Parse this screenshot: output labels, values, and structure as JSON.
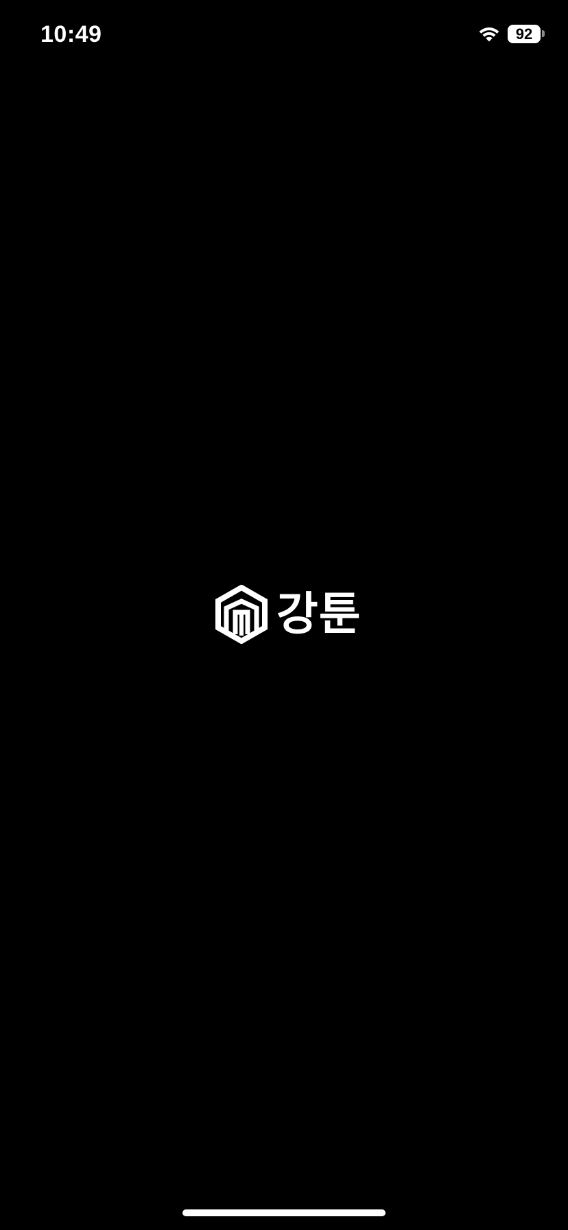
{
  "status_bar": {
    "time": "10:49",
    "battery_level": "92",
    "battery_fraction": 0.92,
    "icons": [
      "wifi-icon",
      "battery-icon"
    ]
  },
  "splash": {
    "logo_icon": "hexagon-building-logo-icon",
    "brand_name": "강툰"
  },
  "colors": {
    "background": "#000000",
    "foreground": "#ffffff"
  }
}
